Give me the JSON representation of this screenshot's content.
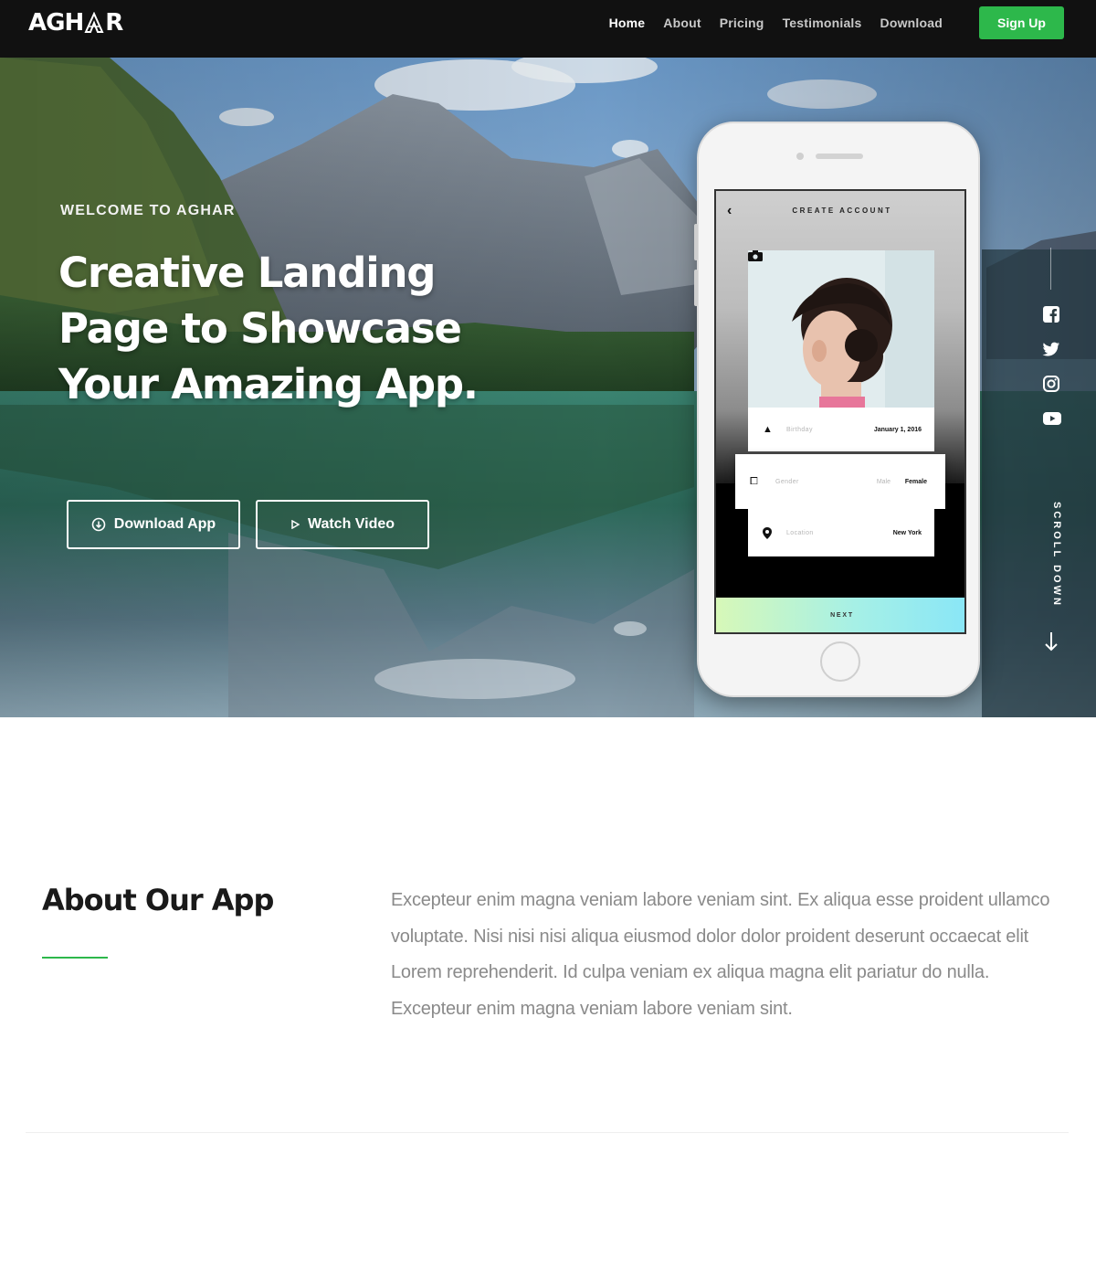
{
  "navbar": {
    "logo_text_left": "AGH",
    "logo_text_right": "R",
    "links": [
      "Home",
      "About",
      "Pricing",
      "Testimonials",
      "Download"
    ],
    "active_link": "Home",
    "signup_label": "Sign Up",
    "accent_color": "#2db84b"
  },
  "hero": {
    "eyebrow": "WELCOME TO AGHAR",
    "headline": "Creative Landing Page to Showcase Your Amazing App.",
    "download_button": "Download App",
    "download_icon": "download-circle-icon",
    "video_button": "Watch Video",
    "video_icon": "play-icon",
    "scroll_label": "SCROLL DOWN"
  },
  "phone_screen": {
    "title": "CREATE ACCOUNT",
    "birthday_label": "Birthday",
    "birthday_value": "January 1, 2016",
    "gender_label": "Gender",
    "gender_option_a": "Male",
    "gender_option_b": "Female",
    "location_label": "Location",
    "location_value": "New York",
    "next_label": "NEXT"
  },
  "social": [
    "facebook-icon",
    "twitter-icon",
    "instagram-icon",
    "youtube-icon"
  ],
  "about": {
    "title": "About Our App",
    "body": "Excepteur enim magna veniam labore veniam sint. Ex aliqua esse proident ullamco voluptate. Nisi nisi nisi aliqua eiusmod dolor dolor proident deserunt occaecat elit Lorem reprehenderit. Id culpa veniam ex aliqua magna elit pariatur do nulla. Excepteur enim magna veniam labore veniam sint."
  }
}
